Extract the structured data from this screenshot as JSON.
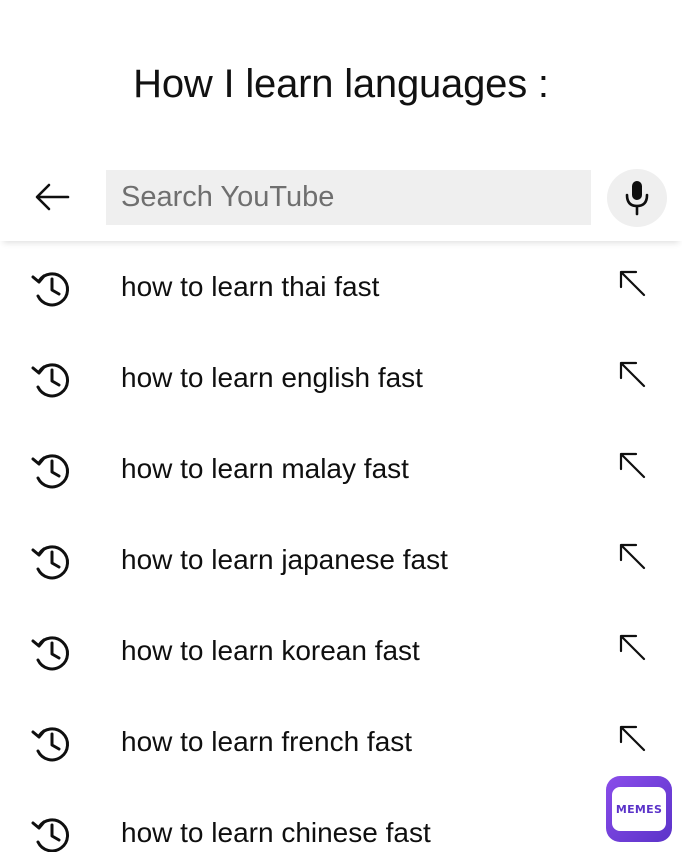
{
  "caption": "How I learn languages :",
  "search": {
    "placeholder": "Search YouTube",
    "value": ""
  },
  "icons": {
    "back": "arrow-left-icon",
    "mic": "microphone-icon",
    "history": "history-clock-icon",
    "fill": "arrow-up-left-icon"
  },
  "suggestions": [
    {
      "text": "how to learn thai fast"
    },
    {
      "text": "how to learn english fast"
    },
    {
      "text": "how to learn malay fast"
    },
    {
      "text": "how to learn japanese fast"
    },
    {
      "text": "how to learn korean fast"
    },
    {
      "text": "how to learn french fast"
    },
    {
      "text": "how to learn chinese fast"
    }
  ],
  "watermark": {
    "label": "MEMES"
  },
  "colors": {
    "input_background": "#efefef",
    "text": "#0f0f0f",
    "watermark": "#6c3ad8"
  }
}
